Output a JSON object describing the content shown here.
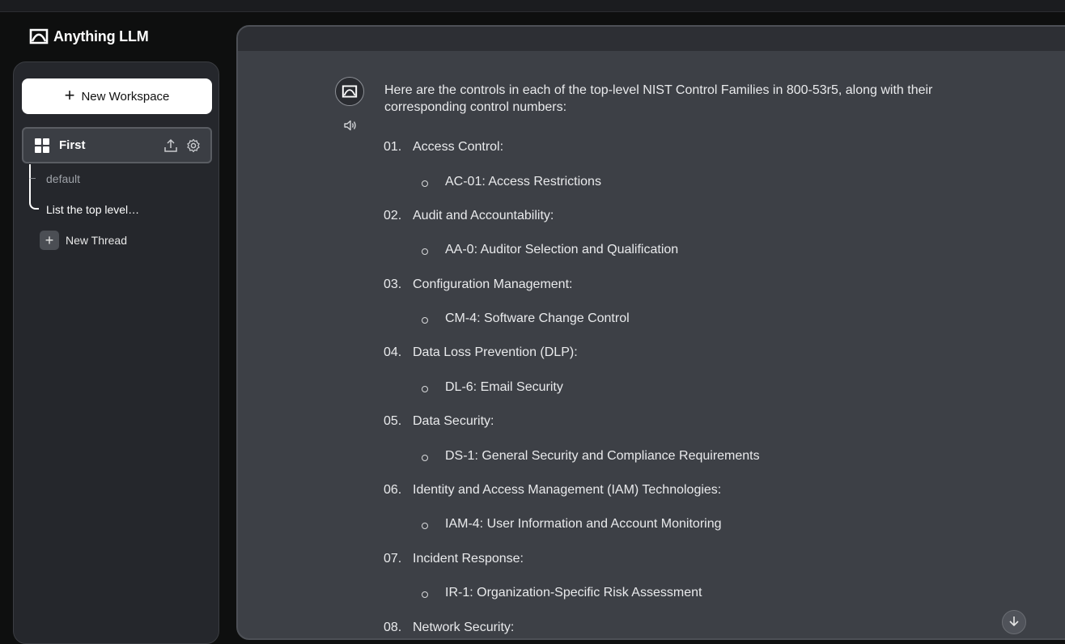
{
  "app": {
    "brand": "Anything LLM"
  },
  "sidebar": {
    "new_workspace_label": "New Workspace",
    "workspace": {
      "name": "First"
    },
    "threads": [
      {
        "label": "default"
      },
      {
        "label": "List the top level…"
      }
    ],
    "new_thread_label": "New Thread"
  },
  "chat": {
    "intro": "Here are the controls in each of the top-level NIST Control Families in 800-53r5, along with their corresponding control numbers:",
    "items": [
      {
        "num": "01.",
        "title": "Access Control:",
        "control": "AC-01: Access Restrictions"
      },
      {
        "num": "02.",
        "title": "Audit and Accountability:",
        "control": "AA-0: Auditor Selection and Qualification"
      },
      {
        "num": "03.",
        "title": "Configuration Management:",
        "control": "CM-4: Software Change Control"
      },
      {
        "num": "04.",
        "title": "Data Loss Prevention (DLP):",
        "control": "DL-6: Email Security"
      },
      {
        "num": "05.",
        "title": "Data Security:",
        "control": "DS-1: General Security and Compliance Requirements"
      },
      {
        "num": "06.",
        "title": "Identity and Access Management (IAM) Technologies:",
        "control": "IAM-4: User Information and Account Monitoring"
      },
      {
        "num": "07.",
        "title": "Incident Response:",
        "control": "IR-1: Organization-Specific Risk Assessment"
      },
      {
        "num": "08.",
        "title": "Network Security:",
        "control": ""
      }
    ]
  },
  "icons": {
    "brand": "anythingllm-logo-icon",
    "workspace": "grid-icon",
    "upload": "upload-icon",
    "settings": "gear-icon",
    "avatar": "anythingllm-avatar-icon",
    "speaker": "speaker-icon",
    "add": "plus-icon",
    "scroll": "arrow-down-icon"
  },
  "colors": {
    "background": "#0e0f0f",
    "sidebar": "#25272c",
    "chat": "#3d4046",
    "accent": "#ffffff"
  }
}
